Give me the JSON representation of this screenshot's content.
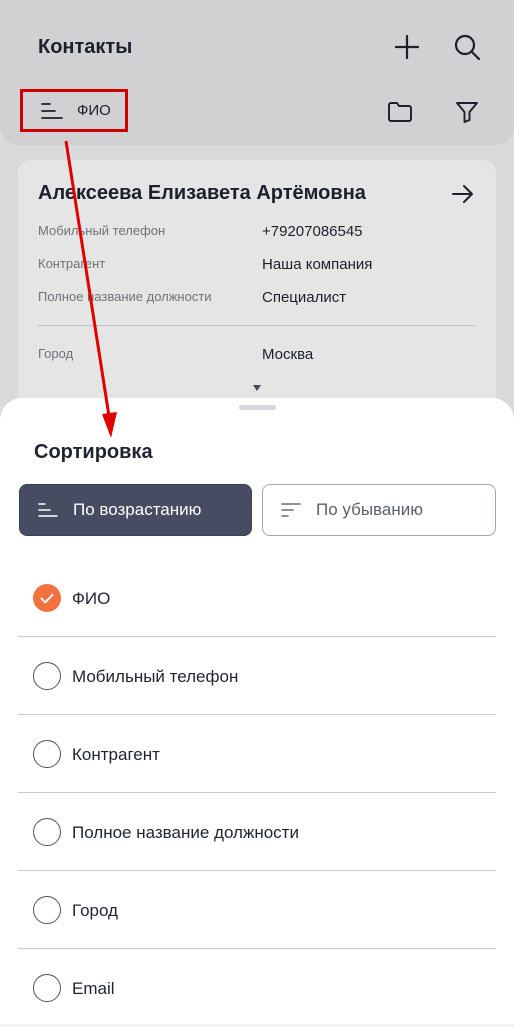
{
  "header": {
    "title": "Контакты"
  },
  "sort_chip": {
    "label": "ФИО"
  },
  "card": {
    "name": "Алексеева Елизавета Артёмовна",
    "rows": [
      {
        "key": "Мобильный телефон",
        "value": "+79207086545"
      },
      {
        "key": "Контрагент",
        "value": "Наша компания"
      },
      {
        "key": "Полное название должности",
        "value": "Специалист"
      },
      {
        "key": "Город",
        "value": "Москва"
      }
    ]
  },
  "sheet": {
    "title": "Сортировка",
    "asc_label": "По возрастанию",
    "desc_label": "По убыванию",
    "options": [
      {
        "label": "ФИО",
        "checked": true
      },
      {
        "label": "Мобильный телефон",
        "checked": false
      },
      {
        "label": "Контрагент",
        "checked": false
      },
      {
        "label": "Полное название должности",
        "checked": false
      },
      {
        "label": "Город",
        "checked": false
      },
      {
        "label": "Email",
        "checked": false
      }
    ]
  },
  "colors": {
    "accent": "#f2713e",
    "annotation": "#e10000",
    "active_segment": "#464c61"
  }
}
